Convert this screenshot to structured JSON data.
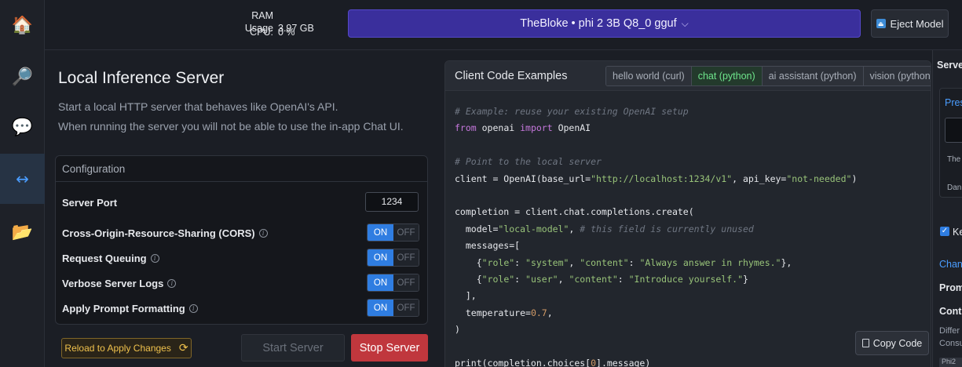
{
  "nav": {
    "items": [
      {
        "name": "home",
        "icon": "🏠"
      },
      {
        "name": "search",
        "icon": "🔎"
      },
      {
        "name": "chat",
        "icon": "💬"
      },
      {
        "name": "server",
        "icon": "↔"
      },
      {
        "name": "models",
        "icon": "📂"
      }
    ]
  },
  "topbar": {
    "ram_label": "RAM Usage",
    "ram_value": "3.97 GB",
    "cpu_label": "CPU:",
    "cpu_value": "0 %",
    "model_name": "TheBloke • phi 2 3B Q8_0 gguf",
    "model_chevron": "⌵",
    "eject_label": "Eject Model"
  },
  "server": {
    "title": "Local Inference Server",
    "desc_line1": "Start a local HTTP server that behaves like OpenAI's API.",
    "desc_line2": "When running the server you will not be able to use the in-app Chat UI.",
    "config_title": "Configuration",
    "port_label": "Server Port",
    "port_value": "1234",
    "on_label": "ON",
    "off_label": "OFF",
    "options": [
      {
        "label": "Cross-Origin-Resource-Sharing (CORS)",
        "value": "ON"
      },
      {
        "label": "Request Queuing",
        "value": "ON"
      },
      {
        "label": "Verbose Server Logs",
        "value": "ON"
      },
      {
        "label": "Apply Prompt Formatting",
        "value": "ON"
      }
    ],
    "reload_label": "Reload to Apply Changes",
    "start_label": "Start Server",
    "stop_label": "Stop Server"
  },
  "code": {
    "title": "Client Code Examples",
    "tabs": [
      "hello world (curl)",
      "chat (python)",
      "ai assistant (python)",
      "vision (python)"
    ],
    "active_tab": "chat (python)",
    "copy_label": "Copy Code",
    "lines": [
      [
        {
          "t": "# Example: reuse your existing OpenAI setup",
          "c": "com"
        }
      ],
      [
        {
          "t": "from",
          "c": "kw"
        },
        {
          "t": " openai ",
          "c": ""
        },
        {
          "t": "import",
          "c": "kw"
        },
        {
          "t": " OpenAI",
          "c": ""
        }
      ],
      [],
      [
        {
          "t": "# Point to the local server",
          "c": "com"
        }
      ],
      [
        {
          "t": "client = OpenAI(base_url=",
          "c": ""
        },
        {
          "t": "\"http://localhost:1234/v1\"",
          "c": "str"
        },
        {
          "t": ", api_key=",
          "c": ""
        },
        {
          "t": "\"not-needed\"",
          "c": "str"
        },
        {
          "t": ")",
          "c": ""
        }
      ],
      [],
      [
        {
          "t": "completion = client.chat.completions.create(",
          "c": ""
        }
      ],
      [
        {
          "t": "  model=",
          "c": ""
        },
        {
          "t": "\"local-model\"",
          "c": "str"
        },
        {
          "t": ", ",
          "c": ""
        },
        {
          "t": "# this field is currently unused",
          "c": "com"
        }
      ],
      [
        {
          "t": "  messages=[",
          "c": ""
        }
      ],
      [
        {
          "t": "    {",
          "c": ""
        },
        {
          "t": "\"role\"",
          "c": "str"
        },
        {
          "t": ": ",
          "c": ""
        },
        {
          "t": "\"system\"",
          "c": "str"
        },
        {
          "t": ", ",
          "c": ""
        },
        {
          "t": "\"content\"",
          "c": "str"
        },
        {
          "t": ": ",
          "c": ""
        },
        {
          "t": "\"Always answer in rhymes.\"",
          "c": "str"
        },
        {
          "t": "},",
          "c": ""
        }
      ],
      [
        {
          "t": "    {",
          "c": ""
        },
        {
          "t": "\"role\"",
          "c": "str"
        },
        {
          "t": ": ",
          "c": ""
        },
        {
          "t": "\"user\"",
          "c": "str"
        },
        {
          "t": ", ",
          "c": ""
        },
        {
          "t": "\"content\"",
          "c": "str"
        },
        {
          "t": ": ",
          "c": ""
        },
        {
          "t": "\"Introduce yourself.\"",
          "c": "str"
        },
        {
          "t": "}",
          "c": ""
        }
      ],
      [
        {
          "t": "  ],",
          "c": ""
        }
      ],
      [
        {
          "t": "  temperature=",
          "c": ""
        },
        {
          "t": "0.7",
          "c": "num"
        },
        {
          "t": ",",
          "c": ""
        }
      ],
      [
        {
          "t": ")",
          "c": ""
        }
      ],
      [],
      [
        {
          "t": "print(completion.choices[",
          "c": ""
        },
        {
          "t": "0",
          "c": "num"
        },
        {
          "t": "].message)",
          "c": ""
        }
      ]
    ]
  },
  "right_panel": {
    "header": "Server",
    "preset": "Pres",
    "text1": "The",
    "text2": "Dan",
    "check_label": "Ke",
    "link": "Chang",
    "prompt": "Promp",
    "context": "Conte",
    "diff": "Differ",
    "consu": "Consu",
    "tag": "Phi2"
  }
}
